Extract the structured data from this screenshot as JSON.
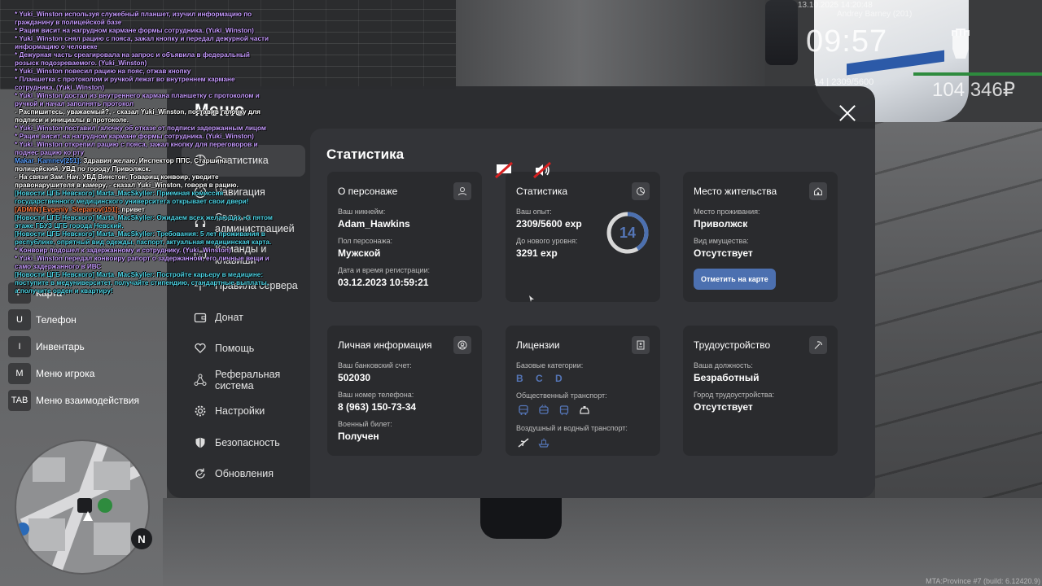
{
  "hud": {
    "datetime": "13.10.2025 14:20:48",
    "player": "Andrey Barney (201)",
    "clock": "09:57",
    "level": "14 | 2309/5600",
    "health_percent": 100,
    "money": "104 346₽",
    "build": "MTA:Province #7 (build: 6.12420.9)"
  },
  "chat": [
    {
      "cls": "me",
      "text": "* Yuki_Winston используя служебный планшет, изучил информацию по гражданину в полицейской базе"
    },
    {
      "cls": "me",
      "text": "* Рация висит на нагрудном кармане формы сотрудника. (Yuki_Winston)"
    },
    {
      "cls": "me",
      "text": "* Yuki_Winston снял рацию с пояса, зажал кнопку и передал дежурной части информацию о человеке"
    },
    {
      "cls": "me",
      "text": "* Дежурная часть среагировала на запрос и объявила в федеральный розыск подозреваемого. (Yuki_Winston)"
    },
    {
      "cls": "me",
      "text": "* Yuki_Winston повесил рацию на пояс, отжав кнопку"
    },
    {
      "cls": "me",
      "text": "* Планшетка с протоколом и ручкой лежат во внутреннем кармане сотрудника. (Yuki_Winston)"
    },
    {
      "cls": "me",
      "text": "* Yuki_Winston достал из внутреннего кармана планшетку с протоколом и ручкой и начал заполнять протокол"
    },
    {
      "cls": "talk",
      "text": "- Распишитесь, уважаемый?, - сказал Yuki_Winston, поставив галочку для подписи и инициалы в протоколе."
    },
    {
      "cls": "me",
      "text": "* Yuki_Winston поставил галочку об отказе от подписи задержанным лицом"
    },
    {
      "cls": "me",
      "text": "* Рация висит на нагрудном кармане формы сотрудника. (Yuki_Winston)"
    },
    {
      "cls": "me",
      "text": "* Yuki_Winston открепил рацию с пояса, зажал кнопку для переговоров и поднес рацию ко рту"
    },
    {
      "cls": "nick",
      "text": "Makar_Kamnev[251]:",
      "rest": " Здравия желаю, Инспектор ППС, Старшина полицейский, УВД по городу Приволжск."
    },
    {
      "cls": "talk",
      "text": "- На связи Зам. Нач. УВД Винстон. Товарищ конвоир, уведите правонарушителя в камеру, - сказал Yuki_Winston, говоря в рацию."
    },
    {
      "cls": "news",
      "text": "[Новости ЦГБ Невского] Marta_MacSkyller: Приемная комиссия государственного медицинского университета открывает свои двери!"
    },
    {
      "cls": "admin",
      "text": "[ADMIN] Evgeniy_Stepanov[151]:",
      "rest": " привет"
    },
    {
      "cls": "news",
      "text": "[Новости ЦГБ Невского] Marta_MacSkyller: Ожидаем всех желающих на пятом этаже ГБУЗ ЦГБ города Невский."
    },
    {
      "cls": "news",
      "text": "[Новости ЦГБ Невского] Marta_MacSkyller: Требования: 5 лет проживания в республике, опрятный вид одежды, паспорт, актуальная медицинская карта."
    },
    {
      "cls": "me",
      "text": "* Конвоир подошел к задержанному и сотруднику. (Yuki_Winston)"
    },
    {
      "cls": "me",
      "text": "* Yuki_Winston передал конвоиру рапорт о задержанном, его личные вещи и само задержанного в ИВС"
    },
    {
      "cls": "news",
      "text": "[Новости ЦГБ Невского] Marta_MacSkyller: Постройте карьеру в медицине: поступите в медуниверситет, получайте стипендию, стандартные выплаты, а получите орден и квартиру!"
    }
  ],
  "keys": [
    {
      "key": "F",
      "label": "Карта"
    },
    {
      "key": "U",
      "label": "Телефон"
    },
    {
      "key": "I",
      "label": "Инвентарь"
    },
    {
      "key": "M",
      "label": "Меню игрока"
    },
    {
      "key": "TAB",
      "label": "Меню взаимодействия"
    }
  ],
  "minimap": {
    "north": "N"
  },
  "menu": {
    "title": "Меню",
    "nav": [
      {
        "label": "Статистика",
        "icon": "stats-icon",
        "active": true
      },
      {
        "label": "Навигация",
        "icon": "compass-icon"
      },
      {
        "label": "Связь с администрацией",
        "icon": "headset-icon"
      },
      {
        "label": "Команды и клавиши",
        "icon": "keyboard-icon"
      },
      {
        "label": "Правила сервера",
        "icon": "rules-icon"
      },
      {
        "label": "Донат",
        "icon": "wallet-icon"
      },
      {
        "label": "Помощь",
        "icon": "heart-hand-icon"
      },
      {
        "label": "Реферальная система",
        "icon": "network-icon"
      },
      {
        "label": "Настройки",
        "icon": "gear-icon"
      },
      {
        "label": "Безопасность",
        "icon": "shield-icon"
      },
      {
        "label": "Обновления",
        "icon": "refresh-icon"
      }
    ],
    "section_title": "Статистика",
    "character": {
      "title": "О персонаже",
      "nick_label": "Ваш никнейм:",
      "nick": "Adam_Hawkins",
      "gender_label": "Пол персонажа:",
      "gender": "Мужской",
      "reg_label": "Дата и время регистрации:",
      "reg": "03.12.2023 10:59:21"
    },
    "stats": {
      "title": "Статистика",
      "exp_label": "Ваш опыт:",
      "exp": "2309/5600 exp",
      "next_label": "До нового уровня:",
      "next": "3291 exp",
      "level": "14",
      "progress": 0.4123
    },
    "residence": {
      "title": "Место жительства",
      "place_label": "Место проживания:",
      "place": "Приволжск",
      "property_label": "Вид имущества:",
      "property": "Отсутствует",
      "button": "Отметить на карте"
    },
    "personal": {
      "title": "Личная информация",
      "bank_label": "Ваш банковский счет:",
      "bank": "502030",
      "phone_label": "Ваш номер телефона:",
      "phone": "8 (963) 150-73-34",
      "military_label": "Военный билет:",
      "military": "Получен"
    },
    "licenses": {
      "title": "Лицензии",
      "basic_label": "Базовые категории:",
      "basic": "B C D",
      "public_label": "Общественный транспорт:",
      "air_label": "Воздушный и водный транспорт:"
    },
    "employment": {
      "title": "Трудоустройство",
      "position_label": "Ваша должность:",
      "position": "Безработный",
      "city_label": "Город трудоустройства:",
      "city": "Отсутствует"
    }
  },
  "colors": {
    "accent": "#4c70b0",
    "category": "#5576b8"
  }
}
